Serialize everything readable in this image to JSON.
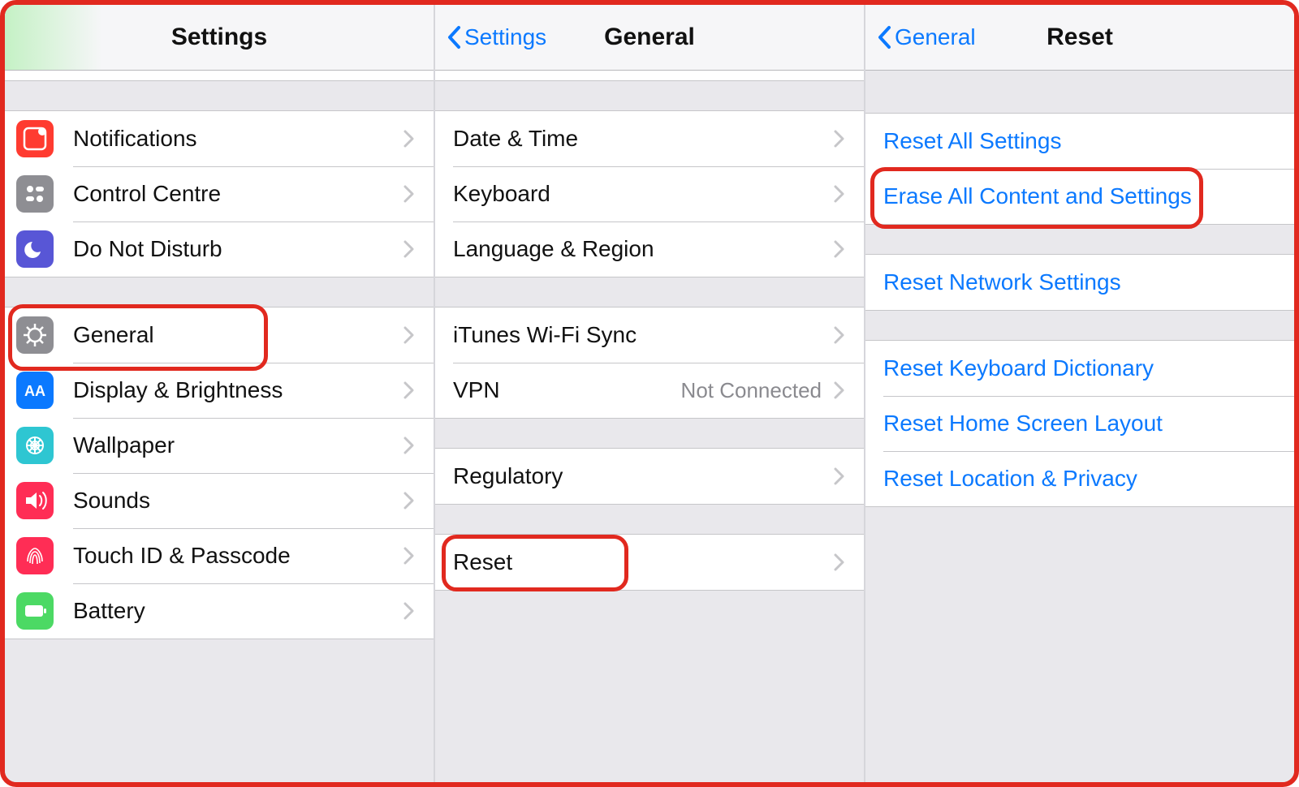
{
  "panes": {
    "settings": {
      "title": "Settings",
      "items": [
        {
          "label": "Notifications",
          "icon": "notifications",
          "color": "#ff3b30"
        },
        {
          "label": "Control Centre",
          "icon": "control",
          "color": "#8e8e93"
        },
        {
          "label": "Do Not Disturb",
          "icon": "dnd",
          "color": "#5856d6"
        },
        {
          "label": "General",
          "icon": "general",
          "color": "#8e8e93"
        },
        {
          "label": "Display & Brightness",
          "icon": "display",
          "color": "#0b79ff"
        },
        {
          "label": "Wallpaper",
          "icon": "wallpaper",
          "color": "#2ec6d2"
        },
        {
          "label": "Sounds",
          "icon": "sounds",
          "color": "#ff2d55"
        },
        {
          "label": "Touch ID & Passcode",
          "icon": "touchid",
          "color": "#ff2d55"
        },
        {
          "label": "Battery",
          "icon": "battery",
          "color": "#4cd964"
        }
      ]
    },
    "general": {
      "back": "Settings",
      "title": "General",
      "groups": [
        [
          "Date & Time",
          "Keyboard",
          "Language & Region"
        ],
        [
          "iTunes Wi-Fi Sync",
          "VPN"
        ],
        [
          "Regulatory"
        ],
        [
          "Reset"
        ]
      ],
      "vpn_detail": "Not Connected"
    },
    "reset": {
      "back": "General",
      "title": "Reset",
      "groups": [
        [
          "Reset All Settings",
          "Erase All Content and Settings"
        ],
        [
          "Reset Network Settings"
        ],
        [
          "Reset Keyboard Dictionary",
          "Reset Home Screen Layout",
          "Reset Location & Privacy"
        ]
      ]
    }
  },
  "colors": {
    "link": "#0b79ff",
    "highlight": "#e1291f"
  }
}
